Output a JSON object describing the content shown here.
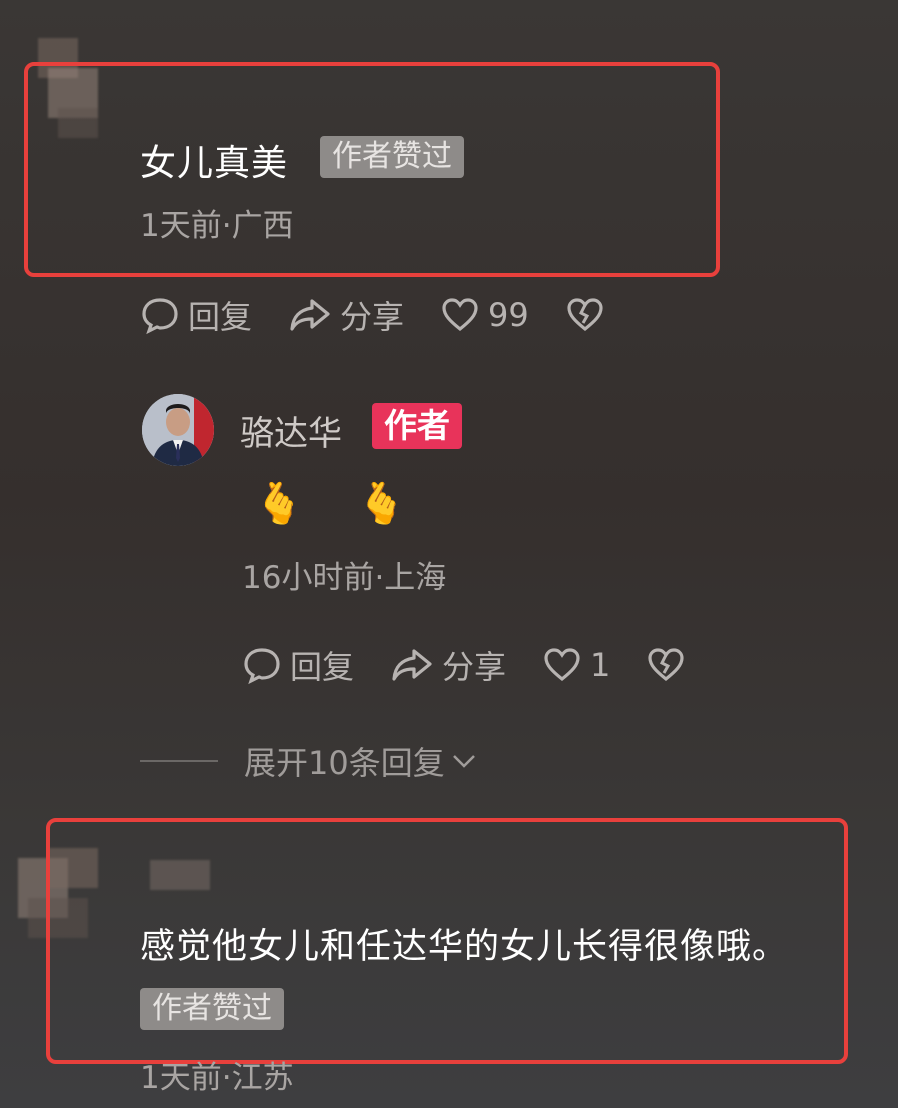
{
  "comments": [
    {
      "text": "女儿真美",
      "badge": "作者赞过",
      "meta": "1天前·广西",
      "actions": {
        "reply": "回复",
        "share": "分享",
        "likes": "99"
      }
    },
    {
      "text": "感觉他女儿和任达华的女儿长得很像哦。",
      "badge": "作者赞过",
      "meta": "1天前·江苏"
    }
  ],
  "author_reply": {
    "name": "骆达华",
    "badge": "作者",
    "content": "🫰 🫰",
    "meta": "16小时前·上海",
    "actions": {
      "reply": "回复",
      "share": "分享",
      "likes": "1"
    }
  },
  "expand_replies": "展开10条回复",
  "colors": {
    "highlight": "#e8403c",
    "author_badge": "#e8335a",
    "liked_badge": "#8e8b89"
  },
  "icons": [
    "comment-icon",
    "share-icon",
    "heart-icon",
    "broken-heart-icon",
    "chevron-down-icon"
  ]
}
